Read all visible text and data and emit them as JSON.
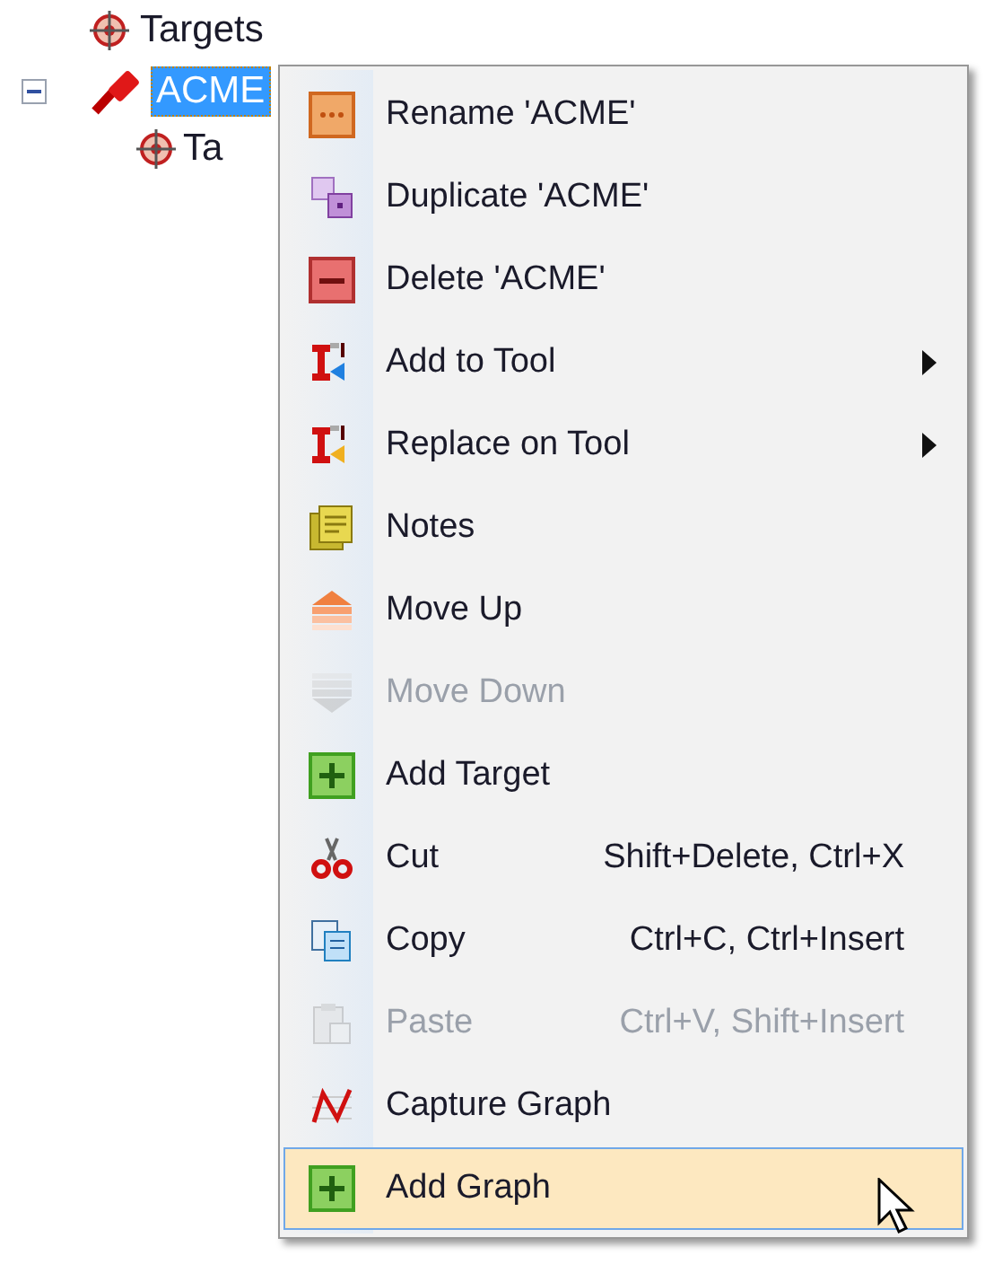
{
  "tree": [
    {
      "label": "Targets",
      "selected": false
    },
    {
      "label": "ACME",
      "selected": true,
      "expanded": true,
      "children": [
        {
          "label": "Ta",
          "selected": false
        }
      ]
    }
  ],
  "context_menu": {
    "items": [
      {
        "label": "Rename 'ACME'",
        "disabled": false,
        "submenu": false,
        "selected": false
      },
      {
        "label": "Duplicate 'ACME'",
        "disabled": false,
        "submenu": false,
        "selected": false
      },
      {
        "label": "Delete 'ACME'",
        "disabled": false,
        "submenu": false,
        "selected": false
      },
      {
        "label": "Add to Tool",
        "disabled": false,
        "submenu": true,
        "selected": false
      },
      {
        "label": "Replace on Tool",
        "disabled": false,
        "submenu": true,
        "selected": false
      },
      {
        "label": "Notes",
        "disabled": false,
        "submenu": false,
        "selected": false
      },
      {
        "label": "Move Up",
        "disabled": false,
        "submenu": false,
        "selected": false
      },
      {
        "label": "Move Down",
        "disabled": true,
        "submenu": false,
        "selected": false
      },
      {
        "label": "Add Target",
        "disabled": false,
        "submenu": false,
        "selected": false
      },
      {
        "label": "Cut",
        "shortcut": "Shift+Delete, Ctrl+X",
        "disabled": false,
        "submenu": false,
        "selected": false
      },
      {
        "label": "Copy",
        "shortcut": "Ctrl+C, Ctrl+Insert",
        "disabled": false,
        "submenu": false,
        "selected": false
      },
      {
        "label": "Paste",
        "shortcut": "Ctrl+V, Shift+Insert",
        "disabled": true,
        "submenu": false,
        "selected": false
      },
      {
        "label": "Capture Graph",
        "disabled": false,
        "submenu": false,
        "selected": false
      },
      {
        "label": "Add Graph",
        "disabled": false,
        "submenu": false,
        "selected": true
      }
    ]
  }
}
